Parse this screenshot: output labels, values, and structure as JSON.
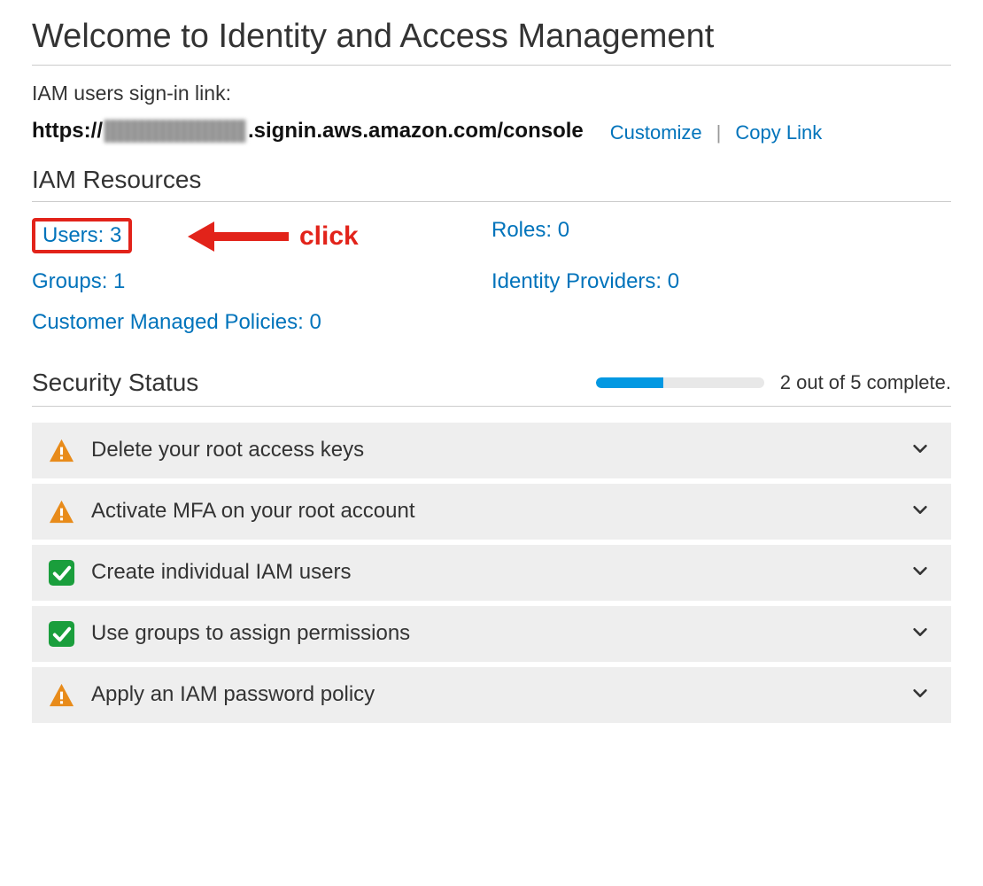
{
  "page_title": "Welcome to Identity and Access Management",
  "signin": {
    "label": "IAM users sign-in link:",
    "url_prefix": "https://",
    "url_suffix": ".signin.aws.amazon.com/console",
    "customize": "Customize",
    "copy": "Copy Link"
  },
  "resources": {
    "heading": "IAM Resources",
    "users": "Users: 3",
    "roles": "Roles: 0",
    "groups": "Groups: 1",
    "identity_providers": "Identity Providers: 0",
    "policies": "Customer Managed Policies: 0"
  },
  "annotation": {
    "click": "click"
  },
  "security": {
    "heading": "Security Status",
    "progress_text": "2 out of 5 complete.",
    "items": [
      {
        "label": "Delete your root access keys",
        "status": "warn"
      },
      {
        "label": "Activate MFA on your root account",
        "status": "warn"
      },
      {
        "label": "Create individual IAM users",
        "status": "done"
      },
      {
        "label": "Use groups to assign permissions",
        "status": "done"
      },
      {
        "label": "Apply an IAM password policy",
        "status": "warn"
      }
    ]
  }
}
